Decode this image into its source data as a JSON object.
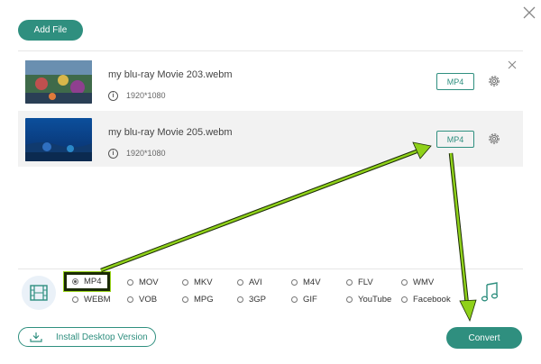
{
  "toolbar": {
    "add_file_label": "Add File"
  },
  "files": [
    {
      "name": "my blu-ray Movie 203.webm",
      "resolution": "1920*1080",
      "format": "MP4"
    },
    {
      "name": "my blu-ray Movie 205.webm",
      "resolution": "1920*1080",
      "format": "MP4"
    }
  ],
  "formats": {
    "row1": [
      "MP4",
      "MOV",
      "MKV",
      "AVI",
      "M4V",
      "FLV",
      "WMV"
    ],
    "row2": [
      "WEBM",
      "VOB",
      "MPG",
      "3GP",
      "GIF",
      "YouTube",
      "Facebook"
    ],
    "selected": "MP4"
  },
  "footer": {
    "install_label": "Install Desktop Version",
    "convert_label": "Convert"
  },
  "colors": {
    "accent": "#2f8f7f",
    "annotation_arrow": "#8fd11a",
    "row_highlight": "#f2f2f2"
  }
}
